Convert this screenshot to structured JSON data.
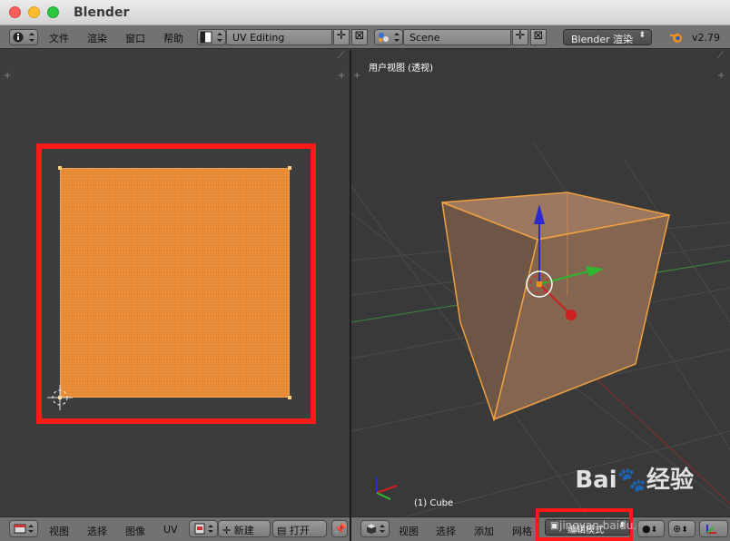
{
  "window": {
    "title": "Blender"
  },
  "topbar": {
    "menus": [
      "文件",
      "渲染",
      "窗口",
      "帮助"
    ],
    "screen_layout": "UV Editing",
    "scene": "Scene",
    "render_engine": "Blender 渲染",
    "version": "v2.79"
  },
  "view3d": {
    "view_label": "用户视图 (透视)",
    "object_label": "(1) Cube"
  },
  "uv_header": {
    "menus": [
      "视图",
      "选择",
      "图像",
      "UV"
    ],
    "new_label": "新建",
    "open_label": "打开"
  },
  "view3d_header": {
    "menus": [
      "视图",
      "选择",
      "添加",
      "网格"
    ],
    "mode": "编辑模式"
  },
  "watermark": {
    "brand": "Bai",
    "brand_cn": "经验",
    "url": "jingyan.baidu.com"
  },
  "colors": {
    "uv_face": "#e6862f",
    "highlight": "#ff1a1a",
    "axis_x": "#cc2020",
    "axis_y": "#2fb52f",
    "axis_z": "#2a2ad0"
  }
}
